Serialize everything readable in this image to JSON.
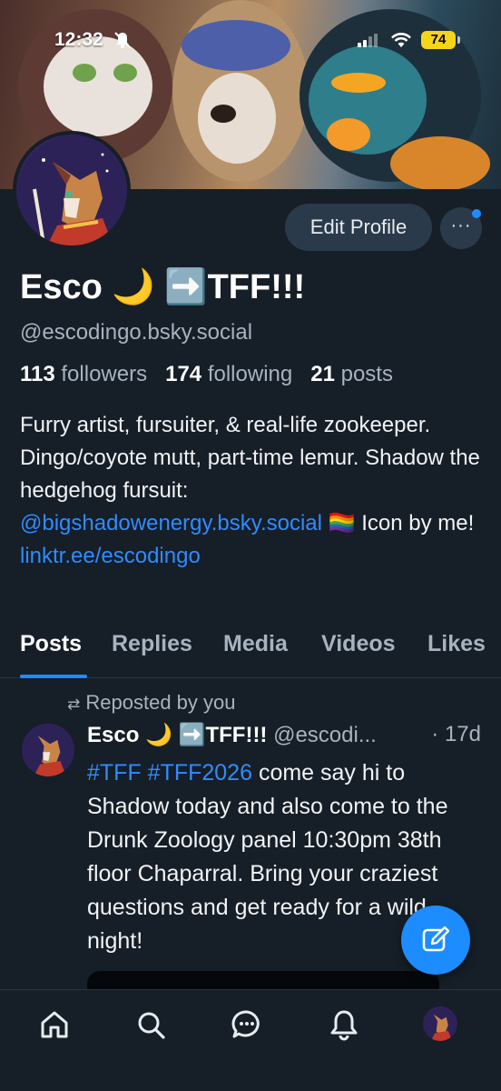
{
  "status_bar": {
    "time": "12:32",
    "battery": "74"
  },
  "profile": {
    "display_name": "Esco 🌙 ➡️TFF!!!",
    "handle": "@escodingo.bsky.social",
    "followers_count": "113",
    "followers_label": "followers",
    "following_count": "174",
    "following_label": "following",
    "posts_count": "21",
    "posts_label": "posts",
    "bio_text_1": "Furry artist, fursuiter, & real-life zookeeper. Dingo/coyote mutt, part-time lemur. Shadow the hedgehog fursuit: ",
    "bio_mention": "@bigshadowenergy.bsky.social",
    "bio_text_2": " 🏳️‍🌈 Icon by me!",
    "bio_link": "linktr.ee/escodingo",
    "edit_profile_label": "Edit Profile",
    "more_label": "···"
  },
  "tabs": [
    "Posts",
    "Replies",
    "Media",
    "Videos",
    "Likes"
  ],
  "post": {
    "repost_label": "Reposted by you",
    "author_name": "Esco 🌙 ➡️TFF!!!",
    "author_handle": "@escodi...",
    "time": "· 17d",
    "hashtags": "#TFF #TFF2026",
    "body": " come say hi to Shadow today and also come to the Drunk Zoology panel 10:30pm 38th floor Chaparral. Bring your craziest questions and get ready for a wild night!"
  },
  "colors": {
    "background": "#161e27",
    "accent": "#1d8cff",
    "muted_text": "#a7b3c0",
    "button_bg": "#2b3a4a"
  },
  "nav_icons": [
    "home-icon",
    "search-icon",
    "chat-icon",
    "bell-icon",
    "profile-avatar"
  ]
}
